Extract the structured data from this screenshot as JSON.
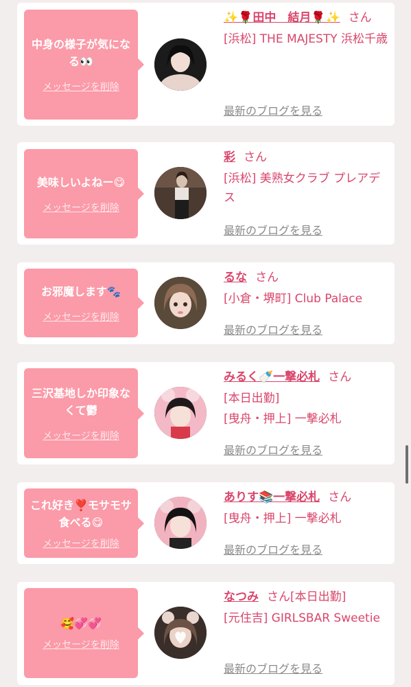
{
  "messages": [
    {
      "bubble": "中身の様子が気になる👀",
      "delete_label": "メッセージを削除",
      "name_prefix": "✨🌹",
      "name": "田中　結月",
      "name_suffix": "🌹✨",
      "san": "さん",
      "details": [
        "[浜松] THE MAJESTY 浜松千歳"
      ],
      "blog_label": "最新のブログを見る"
    },
    {
      "bubble": "美味しいよねー😋",
      "delete_label": "メッセージを削除",
      "name_prefix": "",
      "name": "彩",
      "name_suffix": "",
      "san": "さん",
      "details": [
        "[浜松] 美熟女クラブ プレアデス"
      ],
      "blog_label": "最新のブログを見る"
    },
    {
      "bubble": "お邪魔します🐾",
      "delete_label": "メッセージを削除",
      "name_prefix": "",
      "name": "るな",
      "name_suffix": "",
      "san": "さん",
      "details": [
        "[小倉・堺町] Club Palace"
      ],
      "blog_label": "最新のブログを見る"
    },
    {
      "bubble": "三沢基地しか印象なくて鬱",
      "delete_label": "メッセージを削除",
      "name_prefix": "",
      "name": "みるく🍼一撃必札",
      "name_suffix": "",
      "san": "さん",
      "details": [
        "[本日出勤]",
        "[曳舟・押上] 一撃必札"
      ],
      "blog_label": "最新のブログを見る"
    },
    {
      "bubble": "これ好き❣️モサモサ食べる😋",
      "delete_label": "メッセージを削除",
      "name_prefix": "",
      "name": "ありす📚一撃必札",
      "name_suffix": "",
      "san": "さん",
      "details": [
        "[曳舟・押上] 一撃必札"
      ],
      "blog_label": "最新のブログを見る"
    },
    {
      "bubble": "🥰💞💞",
      "delete_label": "メッセージを削除",
      "name_prefix": "",
      "name": "なつみ",
      "name_suffix": "",
      "san": "さん[本日出勤]",
      "details": [
        "[元住吉] GIRLSBAR Sweetie"
      ],
      "blog_label": "最新のブログを見る"
    }
  ]
}
